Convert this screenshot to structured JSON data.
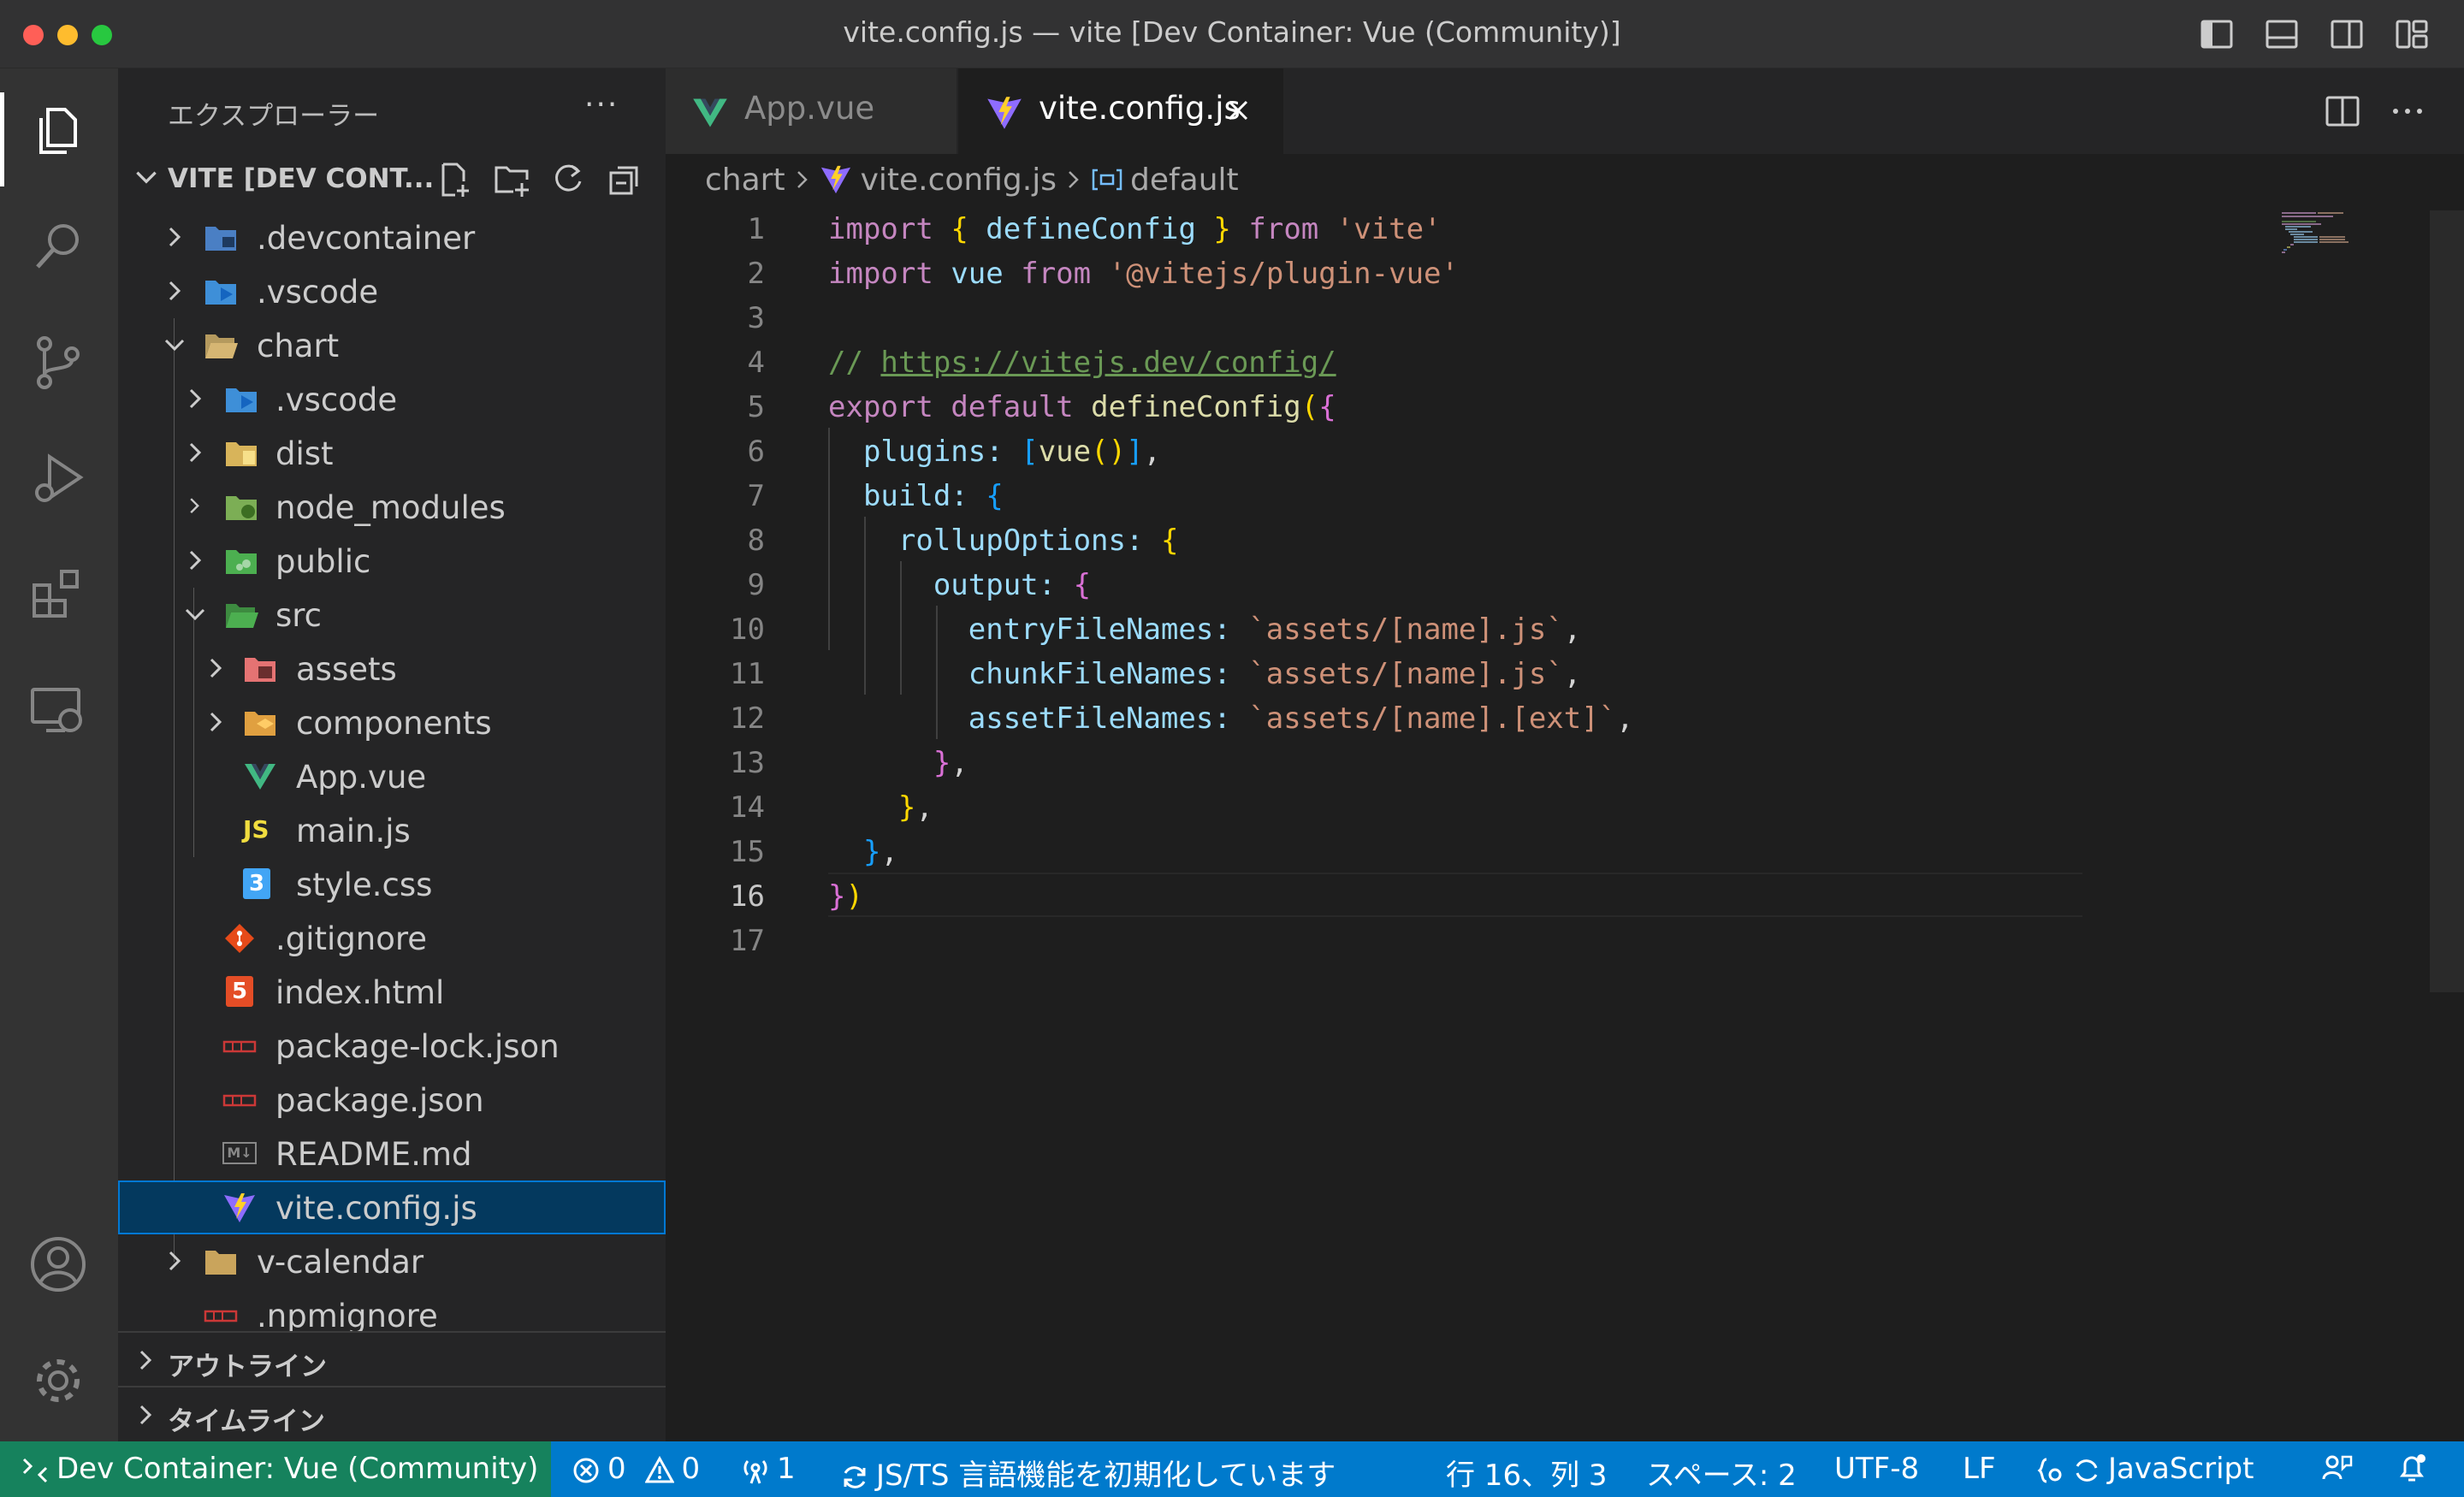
{
  "window": {
    "title": "vite.config.js — vite [Dev Container: Vue (Community)]"
  },
  "activity_bar": {
    "icons": [
      "explorer-icon",
      "search-icon",
      "source-control-icon",
      "run-debug-icon",
      "extensions-icon",
      "remote-explorer-icon",
      "account-icon",
      "gear-icon"
    ]
  },
  "sidebar": {
    "title": "エクスプローラー",
    "more": "···",
    "section_label": "VITE [DEV CONT...",
    "tree": [
      {
        "label": ".devcontainer",
        "icon": "devcontainer-folder-icon",
        "expanded": false
      },
      {
        "label": ".vscode",
        "icon": "vscode-folder-icon",
        "expanded": false
      },
      {
        "label": "chart",
        "icon": "folder-open-icon",
        "expanded": true
      },
      {
        "label": ".vscode",
        "icon": "vscode-folder-icon",
        "expanded": false
      },
      {
        "label": "dist",
        "icon": "dist-folder-icon",
        "expanded": false
      },
      {
        "label": "node_modules",
        "icon": "node-modules-folder-icon",
        "expanded": false
      },
      {
        "label": "public",
        "icon": "public-folder-icon",
        "expanded": false
      },
      {
        "label": "src",
        "icon": "src-folder-icon",
        "expanded": true
      },
      {
        "label": "assets",
        "icon": "assets-folder-icon",
        "expanded": false
      },
      {
        "label": "components",
        "icon": "components-folder-icon",
        "expanded": false
      },
      {
        "label": "App.vue",
        "icon": "vue-file-icon"
      },
      {
        "label": "main.js",
        "icon": "js-file-icon",
        "icon_text": "JS"
      },
      {
        "label": "style.css",
        "icon": "css-file-icon",
        "icon_text": "3"
      },
      {
        "label": ".gitignore",
        "icon": "git-file-icon"
      },
      {
        "label": "index.html",
        "icon": "html-file-icon",
        "icon_text": "5"
      },
      {
        "label": "package-lock.json",
        "icon": "npm-file-icon"
      },
      {
        "label": "package.json",
        "icon": "npm-file-icon"
      },
      {
        "label": "README.md",
        "icon": "markdown-file-icon",
        "icon_text": "M↓"
      },
      {
        "label": "vite.config.js",
        "icon": "vite-file-icon",
        "selected": true
      },
      {
        "label": "v-calendar",
        "icon": "folder-icon",
        "expanded": false
      },
      {
        "label": ".npmignore",
        "icon": "npm-file-icon"
      }
    ],
    "outline_label": "アウトライン",
    "timeline_label": "タイムライン"
  },
  "editor": {
    "tabs": [
      {
        "label": "App.vue",
        "icon": "vue-file-icon",
        "active": false
      },
      {
        "label": "vite.config.js",
        "icon": "vite-file-icon",
        "active": true
      }
    ],
    "breadcrumbs": {
      "folder": "chart",
      "file": "vite.config.js",
      "symbol": "default"
    },
    "current_line": 16,
    "line_numbers": [
      "1",
      "2",
      "3",
      "4",
      "5",
      "6",
      "7",
      "8",
      "9",
      "10",
      "11",
      "12",
      "13",
      "14",
      "15",
      "16",
      "17"
    ],
    "code": {
      "l1": [
        "import",
        "{",
        "defineConfig",
        "}",
        "from",
        "'vite'"
      ],
      "l2": [
        "import",
        "vue",
        "from",
        "'@vitejs/plugin-vue'"
      ],
      "l4": [
        "// ",
        "https://vitejs.dev/config/"
      ],
      "l5": [
        "export",
        "default",
        "defineConfig",
        "(",
        "{"
      ],
      "l6": [
        "plugins:",
        "[",
        "vue",
        "()",
        "]",
        ","
      ],
      "l7": [
        "build:",
        "{"
      ],
      "l8": [
        "rollupOptions:",
        "{"
      ],
      "l9": [
        "output:",
        "{"
      ],
      "l10": [
        "entryFileNames:",
        "`assets/[name].js`",
        ","
      ],
      "l11": [
        "chunkFileNames:",
        "`assets/[name].js`",
        ","
      ],
      "l12": [
        "assetFileNames:",
        "`assets/[name].[ext]`",
        ","
      ],
      "l13": [
        "}",
        ","
      ],
      "l14": [
        "}",
        ","
      ],
      "l15": [
        "}",
        ","
      ],
      "l16": [
        "}",
        ")"
      ]
    }
  },
  "statusbar": {
    "remote": "Dev Container: Vue (Community)",
    "errors": "0",
    "warnings": "0",
    "ports": "1",
    "language_status": "JS/TS 言語機能を初期化しています",
    "position": "行 16、列 3",
    "spaces": "スペース: 2",
    "encoding": "UTF-8",
    "eol": "LF",
    "language": "JavaScript"
  },
  "colors": {
    "accent": "#007acc",
    "remote": "#16825d",
    "selection": "#04395e"
  }
}
